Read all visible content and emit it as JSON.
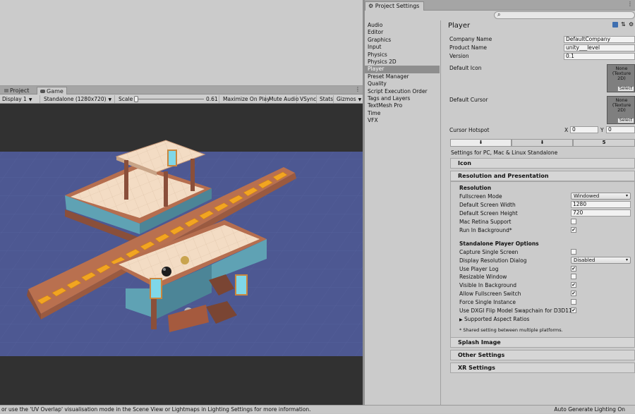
{
  "left_tabs": [
    {
      "label": "Project",
      "icon": "folder-icon"
    },
    {
      "label": "Game",
      "icon": "game-controller-icon"
    }
  ],
  "game_toolbar": {
    "display": "Display 1",
    "resolution": "Standalone (1280x720)",
    "scale_label": "Scale",
    "scale_value": "0.61",
    "scale_fraction": 0.61,
    "maximize": "Maximize On Play",
    "mute": "Mute Audio",
    "vsync": "VSync",
    "stats": "Stats",
    "gizmos": "Gizmos"
  },
  "status": {
    "message": "or use the 'UV Overlap' visualisation mode in the Scene View or Lightmaps in Lighting Settings for more information.",
    "right": "Auto Generate Lighting On"
  },
  "project_settings": {
    "tab_title": "Project Settings",
    "search_placeholder": "",
    "nav": [
      "Audio",
      "Editor",
      "Graphics",
      "Input",
      "Physics",
      "Physics 2D",
      "Player",
      "Preset Manager",
      "Quality",
      "Script Execution Order",
      "Tags and Layers",
      "TextMesh Pro",
      "Time",
      "VFX"
    ],
    "selected_nav": "Player",
    "player": {
      "title": "Player",
      "company_label": "Company Name",
      "company_value": "DefaultCompany",
      "product_label": "Product Name",
      "product_value": "unity___level",
      "version_label": "Version",
      "version_value": "0.1",
      "default_icon_label": "Default Icon",
      "default_cursor_label": "Default Cursor",
      "texture_none": "None\n(Texture\n2D)",
      "select": "Select",
      "hotspot_label": "Cursor Hotspot",
      "hotspot_x_label": "X",
      "hotspot_x": "0",
      "hotspot_y_label": "Y",
      "hotspot_y": "0",
      "settings_for": "Settings for PC, Mac & Linux Standalone",
      "icon_section": "Icon",
      "res_section": "Resolution and Presentation",
      "resolution_sub": "Resolution",
      "fullscreen_label": "Fullscreen Mode",
      "fullscreen_value": "Windowed",
      "width_label": "Default Screen Width",
      "width_value": "1280",
      "height_label": "Default Screen Height",
      "height_value": "720",
      "retina_label": "Mac Retina Support",
      "retina_checked": false,
      "run_bg_label": "Run In Background*",
      "run_bg_checked": true,
      "standalone_sub": "Standalone Player Options",
      "options": [
        {
          "label": "Capture Single Screen",
          "checked": false
        },
        {
          "label": "Display Resolution Dialog",
          "dropdown": "Disabled"
        },
        {
          "label": "Use Player Log",
          "checked": true
        },
        {
          "label": "Resizable Window",
          "checked": false
        },
        {
          "label": "Visible In Background",
          "checked": true
        },
        {
          "label": "Allow Fullscreen Switch",
          "checked": true
        },
        {
          "label": "Force Single Instance",
          "checked": false
        },
        {
          "label": "Use DXGI Flip Model Swapchain for D3D11",
          "checked": true
        }
      ],
      "supported_aspect": "Supported Aspect Ratios",
      "shared_note": "* Shared setting between multiple platforms.",
      "splash_section": "Splash Image",
      "other_section": "Other Settings",
      "xr_section": "XR Settings"
    }
  },
  "colors": {
    "selected_nav": "#8e8e8e",
    "game_background": "#4f5a94",
    "floor": "#f1d8bf",
    "belt": "#c97a55",
    "belt_tile": "#f2a521"
  }
}
